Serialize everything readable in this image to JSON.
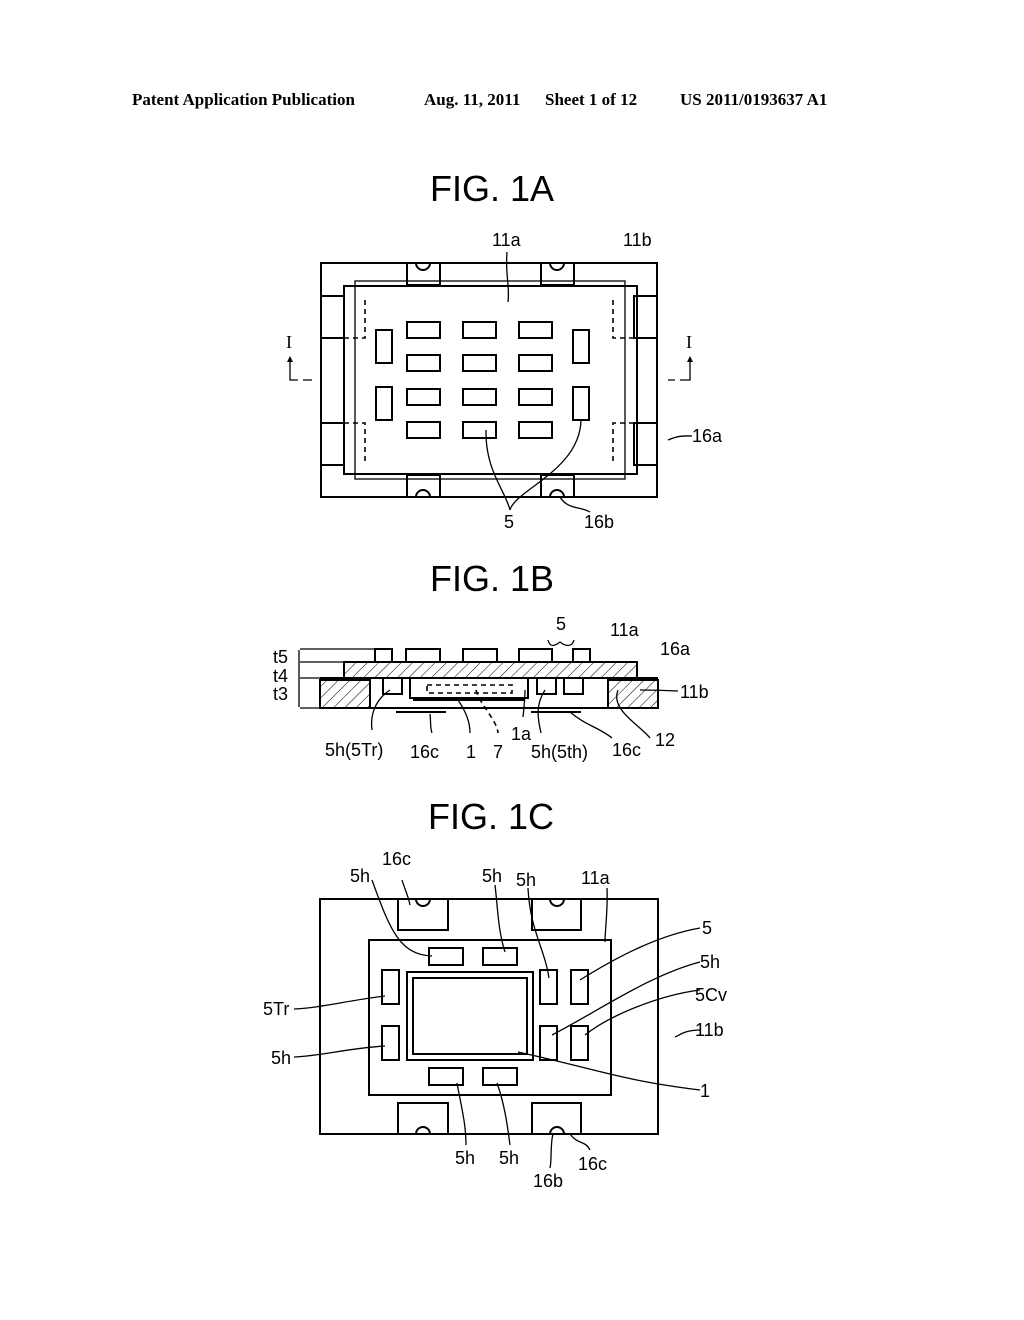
{
  "header": {
    "publication_type": "Patent Application Publication",
    "date": "Aug. 11, 2011",
    "sheet": "Sheet 1 of 12",
    "patent_number": "US 2011/0193637 A1"
  },
  "figures": {
    "fig1a": {
      "title": "FIG. 1A",
      "labels": {
        "l11a": "11a",
        "l11b": "11b",
        "l16a": "16a",
        "l16b": "16b",
        "l5": "5",
        "section_left": "I",
        "section_right": "I"
      }
    },
    "fig1b": {
      "title": "FIG. 1B",
      "labels": {
        "t5": "t5",
        "t4": "t4",
        "t3": "t3",
        "l5": "5",
        "l11a": "11a",
        "l16a": "16a",
        "l11b": "11b",
        "l12": "12",
        "l5hTr": "5h(5Tr)",
        "l16c_left": "16c",
        "l1": "1",
        "l7": "7",
        "l1a": "1a",
        "l5hth": "5h(5th)",
        "l16c_right": "16c"
      }
    },
    "fig1c": {
      "title": "FIG. 1C",
      "labels": {
        "l16c_top": "16c",
        "l5h_a": "5h",
        "l5h_b": "5h",
        "l5h_c": "5h",
        "l11a": "11a",
        "l5": "5",
        "l5h_d": "5h",
        "l5Cv": "5Cv",
        "l11b": "11b",
        "l1": "1",
        "l5Tr": "5Tr",
        "l5h_left": "5h",
        "l5h_bot1": "5h",
        "l5h_bot2": "5h",
        "l16b": "16b",
        "l16c_bot": "16c"
      }
    }
  }
}
